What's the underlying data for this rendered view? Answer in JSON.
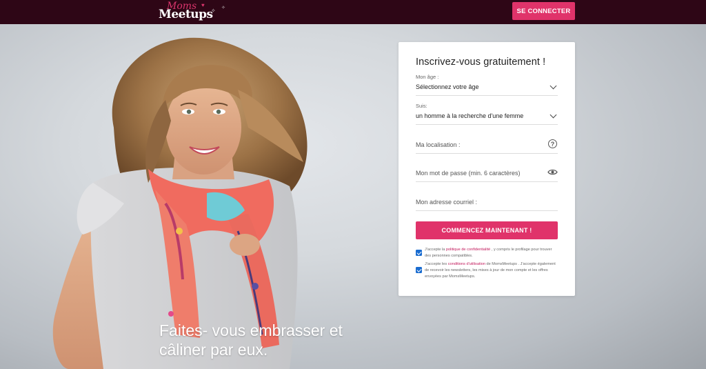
{
  "header": {
    "logo_moms": "Moms",
    "logo_meetups": "Meetups",
    "connect_label": "SE CONNECTER"
  },
  "hero": {
    "tagline_line1": "Faites- vous embrasser et",
    "tagline_line2": "câliner par eux."
  },
  "form": {
    "title": "Inscrivez-vous gratuitement !",
    "age": {
      "label": "Mon âge :",
      "value": "Sélectionnez votre âge"
    },
    "seeking": {
      "label": "Suis:",
      "value": "un homme à la recherche d'une femme"
    },
    "location_placeholder": "Ma localisation :",
    "password_placeholder": "Mon mot de passe (min. 6 caractères)",
    "email_placeholder": "Mon adresse courriel :",
    "submit_label": "COMMENCEZ MAINTENANT !",
    "consent1": {
      "pre": "J'accepte la ",
      "link": "politique de confidentialité",
      "post": " , y compris le profilage pour trouver des personnes compatibles."
    },
    "consent2": {
      "pre": "J'accepte les ",
      "link": "conditions d'utilisation",
      "post": " de MomsMeetups . J'accepte également de recevoir les newsletters, les mises à jour de mon compte et les offres envoyées par MomsMeetups."
    }
  },
  "colors": {
    "header_bg": "#2e0616",
    "accent": "#e0336a",
    "checkbox": "#1a6cd0",
    "link": "#c2185b"
  }
}
